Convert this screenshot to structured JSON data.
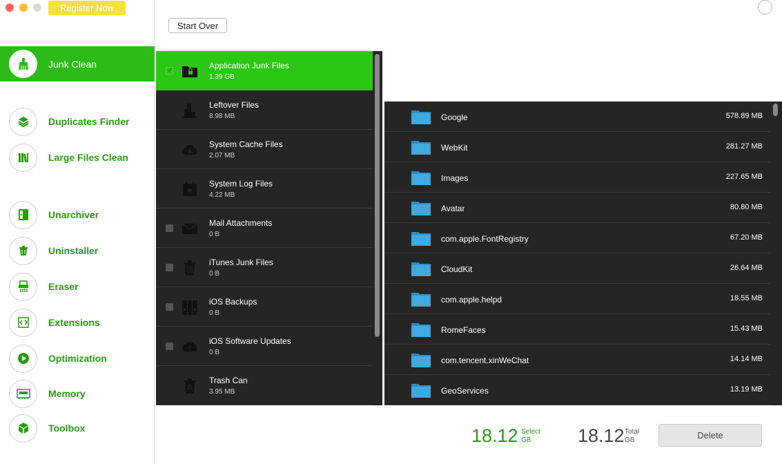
{
  "window": {
    "register_label": "Register Now"
  },
  "sidebar": {
    "items": [
      {
        "label": "Junk Clean",
        "icon": "broom-icon",
        "active": true
      },
      {
        "label": "Duplicates Finder",
        "icon": "layers-icon"
      },
      {
        "label": "Large Files Clean",
        "icon": "books-icon"
      },
      {
        "label": "Unarchiver",
        "icon": "archive-icon"
      },
      {
        "label": "Uninstaller",
        "icon": "trash-icon"
      },
      {
        "label": "Eraser",
        "icon": "shredder-icon"
      },
      {
        "label": "Extensions",
        "icon": "code-icon"
      },
      {
        "label": "Optimization",
        "icon": "play-icon"
      },
      {
        "label": "Memory",
        "icon": "memory-icon"
      },
      {
        "label": "Toolbox",
        "icon": "box-icon"
      }
    ]
  },
  "toolbar": {
    "start_over_label": "Start Over"
  },
  "categories": [
    {
      "name": "Application Junk Files",
      "size": "1.39 GB",
      "icon": "folder-lock-icon",
      "checked": true,
      "selected": true
    },
    {
      "name": "Leftover Files",
      "size": "8.98 MB",
      "icon": "building-icon",
      "checkbox": false
    },
    {
      "name": "System Cache Files",
      "size": "2.07 MB",
      "icon": "cloud-gear-icon",
      "checkbox": false
    },
    {
      "name": "System Log Files",
      "size": "4.22 MB",
      "icon": "calendar-gear-icon",
      "checkbox": false
    },
    {
      "name": "Mail Attachments",
      "size": "0 B",
      "icon": "mail-icon",
      "checkbox": true
    },
    {
      "name": "iTunes Junk Files",
      "size": "0 B",
      "icon": "trash-icon",
      "checkbox": true
    },
    {
      "name": "iOS Backups",
      "size": "0 B",
      "icon": "binders-icon",
      "checkbox": true
    },
    {
      "name": "iOS Software Updates",
      "size": "0 B",
      "icon": "cloud-upload-icon",
      "checkbox": true
    },
    {
      "name": "Trash Can",
      "size": "3.95 MB",
      "icon": "recycle-bin-icon",
      "checkbox": false
    }
  ],
  "files": [
    {
      "name": "Google",
      "size": "578.89 MB"
    },
    {
      "name": "WebKit",
      "size": "281.27 MB"
    },
    {
      "name": "Images",
      "size": "227.65 MB"
    },
    {
      "name": "Avatar",
      "size": "80.80 MB"
    },
    {
      "name": "com.apple.FontRegistry",
      "size": "67.20 MB"
    },
    {
      "name": "CloudKit",
      "size": "26.64 MB"
    },
    {
      "name": "com.apple.helpd",
      "size": "18.55 MB"
    },
    {
      "name": "RomeFaces",
      "size": "15.43 MB"
    },
    {
      "name": "com.tencent.xinWeChat",
      "size": "14.14 MB"
    },
    {
      "name": "GeoServices",
      "size": "13.19 MB"
    }
  ],
  "footer": {
    "select_value": "18.12",
    "select_label": "Select",
    "select_unit": "GB",
    "total_value": "18.12",
    "total_label": "Total",
    "total_unit": "GB",
    "delete_label": "Delete"
  },
  "colors": {
    "accent": "#2bbd16",
    "text_green": "#2a9a10",
    "panel_dark": "#252525",
    "folder_blue": "#3fa9e0"
  }
}
